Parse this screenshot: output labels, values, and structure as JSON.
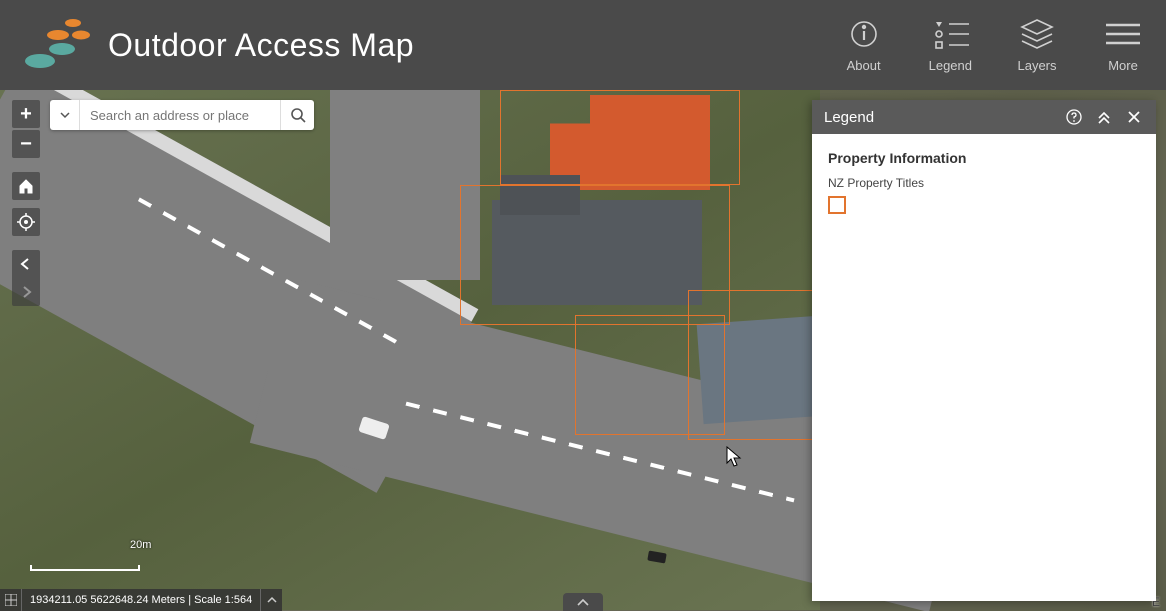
{
  "header": {
    "title": "Outdoor Access Map",
    "nav": {
      "about": "About",
      "legend": "Legend",
      "layers": "Layers",
      "more": "More"
    }
  },
  "search": {
    "placeholder": "Search an address or place"
  },
  "legend_panel": {
    "title": "Legend",
    "section": "Property Information",
    "item": "NZ Property Titles"
  },
  "scalebar": {
    "label": "20m"
  },
  "coord": {
    "text": "1934211.05 5622648.24 Meters | Scale 1:564"
  },
  "attribution": "E",
  "colors": {
    "accent": "#e2742e",
    "header": "#4a4a4a"
  }
}
